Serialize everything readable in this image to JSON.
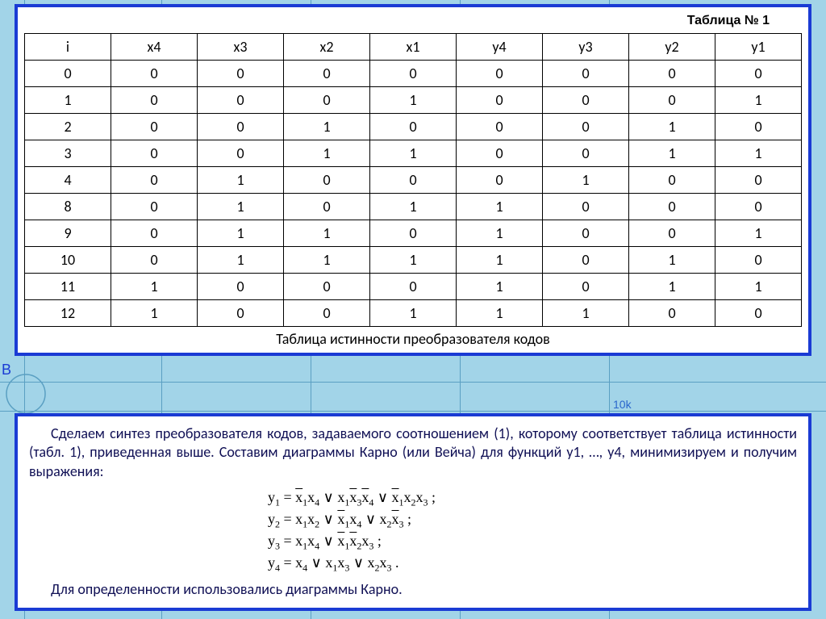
{
  "table": {
    "title": "Таблица № 1",
    "headers": [
      "i",
      "x4",
      "x3",
      "x2",
      "x1",
      "y4",
      "y3",
      "y2",
      "y1"
    ],
    "rows": [
      [
        "0",
        "0",
        "0",
        "0",
        "0",
        "0",
        "0",
        "0",
        "0"
      ],
      [
        "1",
        "0",
        "0",
        "0",
        "1",
        "0",
        "0",
        "0",
        "1"
      ],
      [
        "2",
        "0",
        "0",
        "1",
        "0",
        "0",
        "0",
        "1",
        "0"
      ],
      [
        "3",
        "0",
        "0",
        "1",
        "1",
        "0",
        "0",
        "1",
        "1"
      ],
      [
        "4",
        "0",
        "1",
        "0",
        "0",
        "0",
        "1",
        "0",
        "0"
      ],
      [
        "8",
        "0",
        "1",
        "0",
        "1",
        "1",
        "0",
        "0",
        "0"
      ],
      [
        "9",
        "0",
        "1",
        "1",
        "0",
        "1",
        "0",
        "0",
        "1"
      ],
      [
        "10",
        "0",
        "1",
        "1",
        "1",
        "1",
        "0",
        "1",
        "0"
      ],
      [
        "11",
        "1",
        "0",
        "0",
        "0",
        "1",
        "0",
        "1",
        "1"
      ],
      [
        "12",
        "1",
        "0",
        "0",
        "1",
        "1",
        "1",
        "0",
        "0"
      ]
    ],
    "caption": "Таблица истинности преобразователя кодов"
  },
  "bg": {
    "label": "10k",
    "edge_letter": "B"
  },
  "text": {
    "p1": "Сделаем синтез преобразователя кодов, задаваемого соотношением (1), которому соответствует таблица истинности (табл. 1), приведенная выше. Составим диаграммы Карно (или Вейча) для функций y1, …, y4, минимизируем и получим выражения:",
    "closing": "Для определенности использовались диаграммы Карно."
  },
  "equations": {
    "y1": "y1 = x̄1x4 ∨ x1x̄3x̄4 ∨ x̄1x2x3 ;",
    "y2": "y2 = x1x2 ∨ x̄1x4 ∨ x2x̄3 ;",
    "y3": "y3 = x1x4 ∨ x̄1x̄2x3 ;",
    "y4": "y4 = x4 ∨ x1x3 ∨ x2x3 ."
  }
}
